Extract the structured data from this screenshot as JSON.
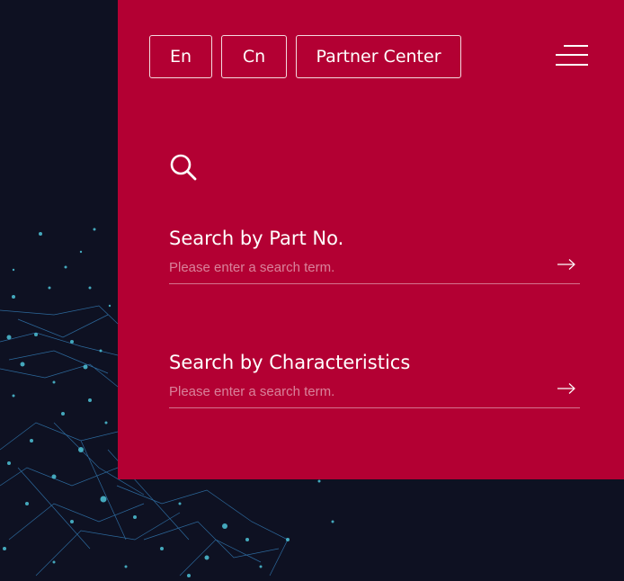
{
  "header": {
    "lang_en": "En",
    "lang_cn": "Cn",
    "partner_center": "Partner Center"
  },
  "search": {
    "part_no": {
      "label": "Search by Part No.",
      "placeholder": "Please enter a search term.",
      "value": ""
    },
    "characteristics": {
      "label": "Search by Characteristics",
      "placeholder": "Please enter a search term.",
      "value": ""
    }
  },
  "icons": {
    "menu": "hamburger-icon",
    "search": "search-icon",
    "submit": "arrow-right-icon"
  },
  "colors": {
    "panel": "#b30033",
    "background": "#0e1122",
    "network": "#3f9fd8"
  }
}
